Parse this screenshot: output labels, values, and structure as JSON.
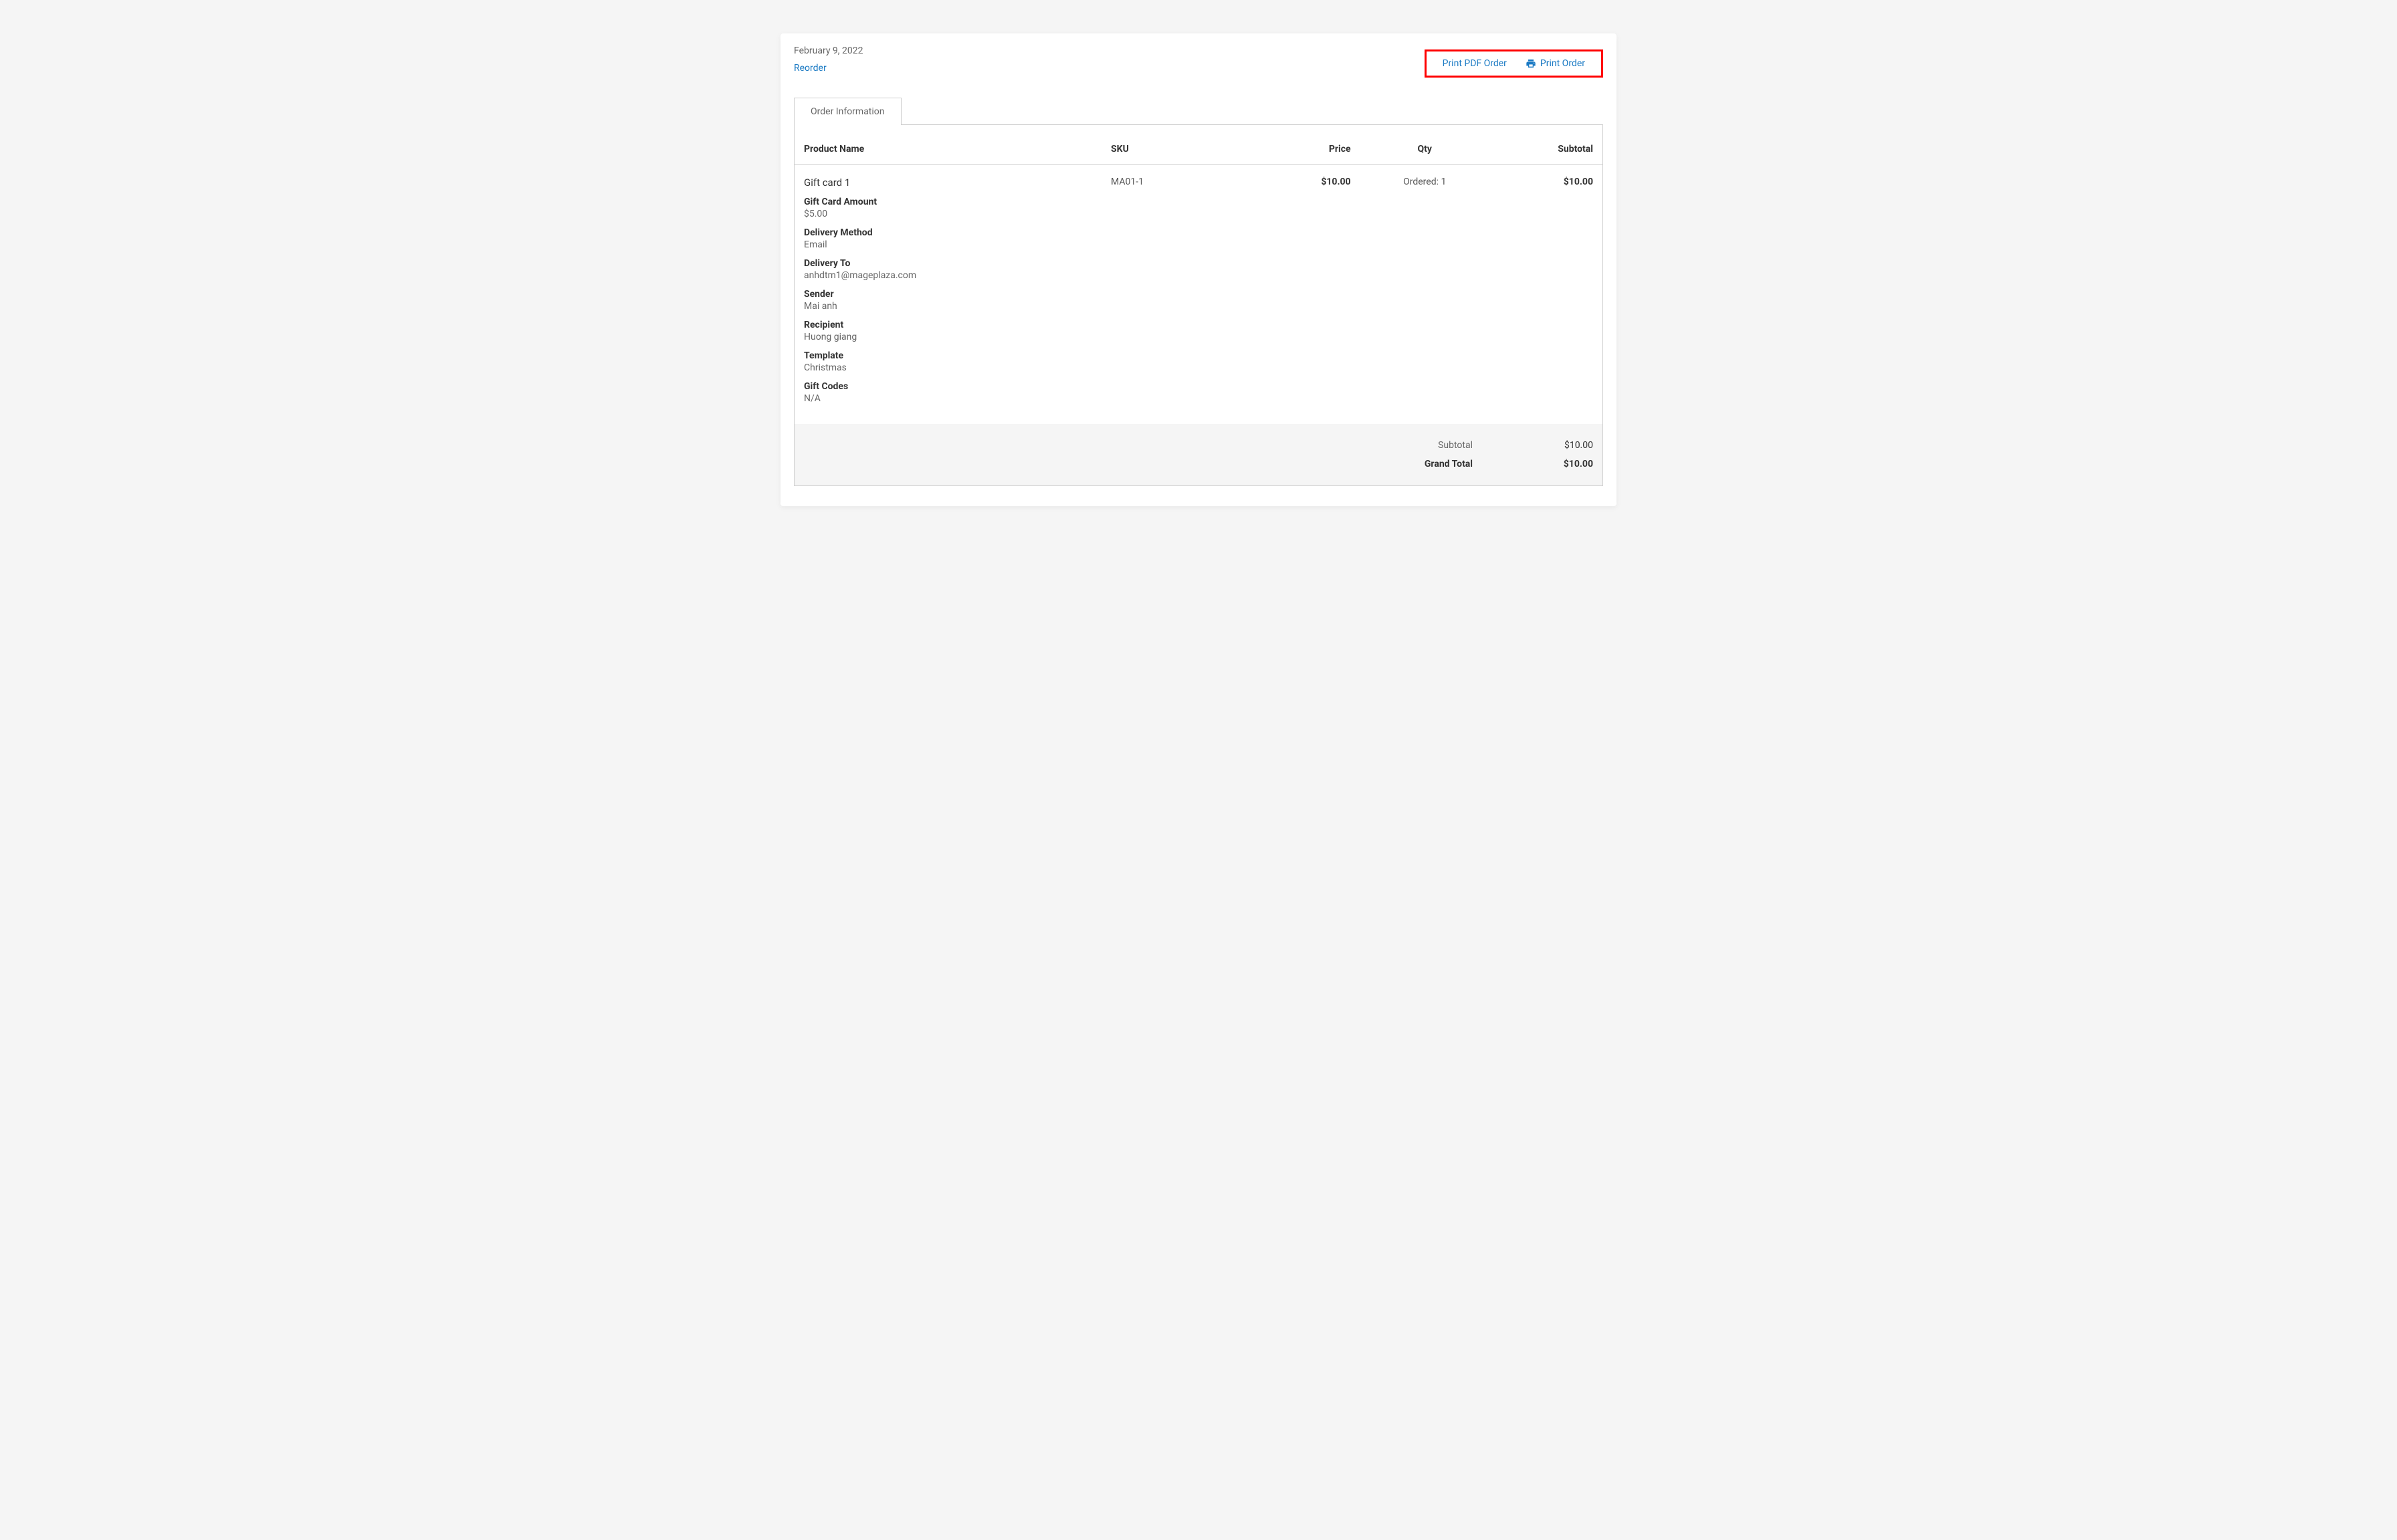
{
  "header": {
    "date": "February 9, 2022",
    "reorder": "Reorder",
    "print_pdf": "Print PDF Order",
    "print_order": "Print Order"
  },
  "tab": {
    "label": "Order Information"
  },
  "table": {
    "headers": {
      "product_name": "Product Name",
      "sku": "SKU",
      "price": "Price",
      "qty": "Qty",
      "subtotal": "Subtotal"
    },
    "row": {
      "product_name": "Gift card 1",
      "sku": "MA01-1",
      "price": "$10.00",
      "qty": "Ordered: 1",
      "subtotal": "$10.00",
      "details": {
        "gift_card_amount_label": "Gift Card Amount",
        "gift_card_amount_value": "$5.00",
        "delivery_method_label": "Delivery Method",
        "delivery_method_value": "Email",
        "delivery_to_label": "Delivery To",
        "delivery_to_value": "anhdtm1@mageplaza.com",
        "sender_label": "Sender",
        "sender_value": "Mai anh",
        "recipient_label": "Recipient",
        "recipient_value": "Huong giang",
        "template_label": "Template",
        "template_value": "Christmas",
        "gift_codes_label": "Gift Codes",
        "gift_codes_value": "N/A"
      }
    }
  },
  "totals": {
    "subtotal_label": "Subtotal",
    "subtotal_value": "$10.00",
    "grand_total_label": "Grand Total",
    "grand_total_value": "$10.00"
  }
}
